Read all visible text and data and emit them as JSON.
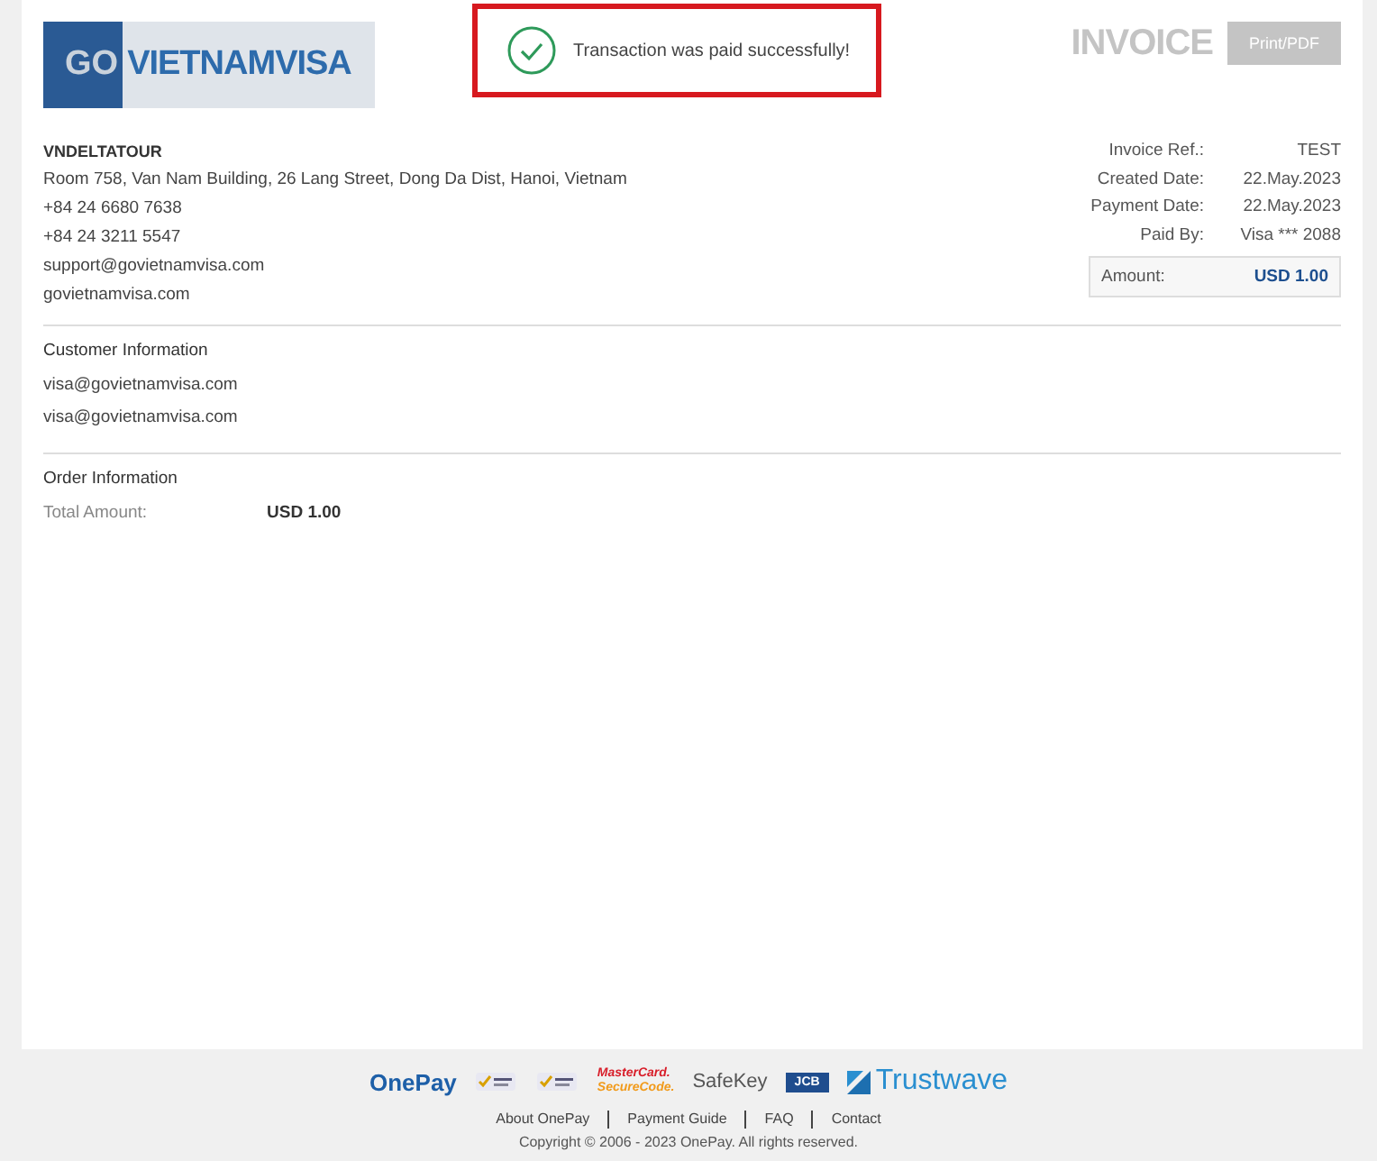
{
  "logo": {
    "text_highlight": "GO",
    "text": "VIETNAMVISA"
  },
  "notice": {
    "kind": "success",
    "message": "Transaction was paid successfully!"
  },
  "header": {
    "title": "INVOICE",
    "print_button": "Print/PDF"
  },
  "merchant": {
    "name": "VNDELTATOUR",
    "lines": [
      "Room 758, Van Nam Building, 26 Lang Street, Dong Da Dist, Hanoi, Vietnam",
      "+84 24 6680 7638",
      "+84 24 3211 5547",
      "support@govietnamvisa.com",
      "govietnamvisa.com"
    ]
  },
  "invoice_details": [
    {
      "label": "Invoice Ref.:",
      "value": "TEST"
    },
    {
      "label": "Created Date:",
      "value": "22.May.2023"
    },
    {
      "label": "Payment Date:",
      "value": "22.May.2023"
    },
    {
      "label": "Paid By:",
      "value": "Visa *** 2088"
    }
  ],
  "amount": {
    "label": "Amount:",
    "value": "USD 1.00"
  },
  "customer": {
    "title": "Customer Information",
    "lines": [
      "visa@govietnamvisa.com",
      "visa@govietnamvisa.com"
    ]
  },
  "order": {
    "title": "Order Information",
    "rows": [
      {
        "label": "Total Amount:",
        "value": "USD 1.00"
      }
    ]
  },
  "footer": {
    "partners": [
      {
        "kind": "onepay",
        "text": "OnePay"
      },
      {
        "kind": "seal"
      },
      {
        "kind": "seal"
      },
      {
        "kind": "mastercard",
        "text": "MasterCard.",
        "sub": "SecureCode."
      },
      {
        "kind": "safekey",
        "text": "SafeKey"
      },
      {
        "kind": "jcb",
        "text": "JCB"
      },
      {
        "kind": "trustwave",
        "text": "Trustwave"
      }
    ],
    "links": [
      "About OnePay",
      "Payment Guide",
      "FAQ",
      "Contact"
    ],
    "copyright": "Copyright © 2006 - 2023 OnePay. All rights reserved."
  }
}
